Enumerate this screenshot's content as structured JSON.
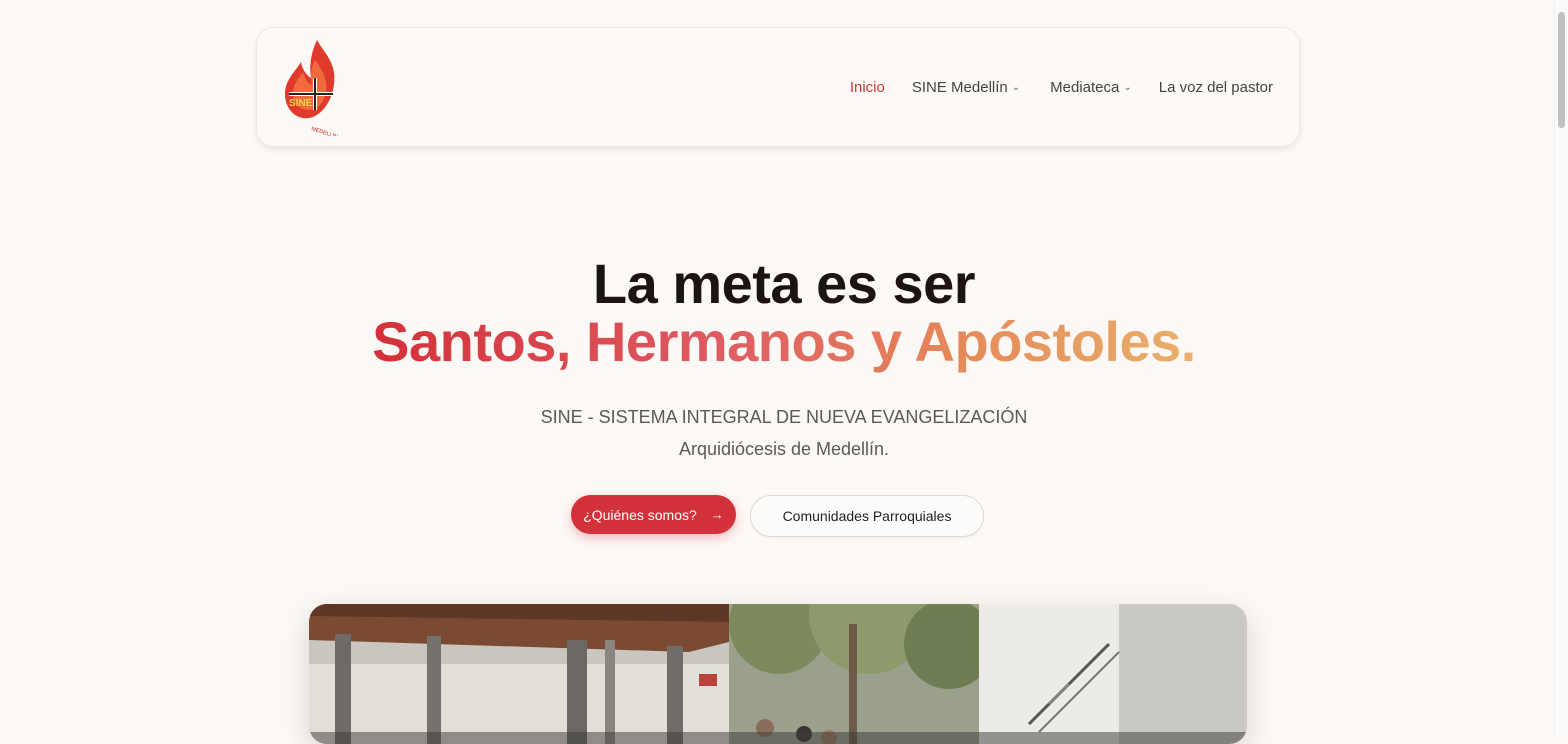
{
  "header": {
    "logo": {
      "icon": "sine-flame-cross-logo",
      "text": "SINE",
      "subtext": "MEDELLÍN"
    },
    "nav": [
      {
        "label": "Inicio",
        "active": true,
        "dropdown": false
      },
      {
        "label": "SINE Medellín",
        "active": false,
        "dropdown": true
      },
      {
        "label": "Mediateca",
        "active": false,
        "dropdown": true
      },
      {
        "label": "La voz del pastor",
        "active": false,
        "dropdown": false
      }
    ]
  },
  "hero": {
    "title_line1": "La meta es ser",
    "title_line2": "Santos, Hermanos y Apóstoles.",
    "subtitle_line1": "SINE - SISTEMA INTEGRAL DE NUEVA EVANGELIZACIÓN",
    "subtitle_line2": "Arquidiócesis de Medellín.",
    "primary_button": "¿Quiénes somos?",
    "primary_icon": "arrow-right-icon",
    "secondary_button": "Comunidades Parroquiales"
  },
  "colors": {
    "accent": "#d4323a",
    "gradient": [
      "#d43039",
      "#df5a62",
      "#e68a5a",
      "#e8b169"
    ],
    "background": "#fcf8f5"
  }
}
